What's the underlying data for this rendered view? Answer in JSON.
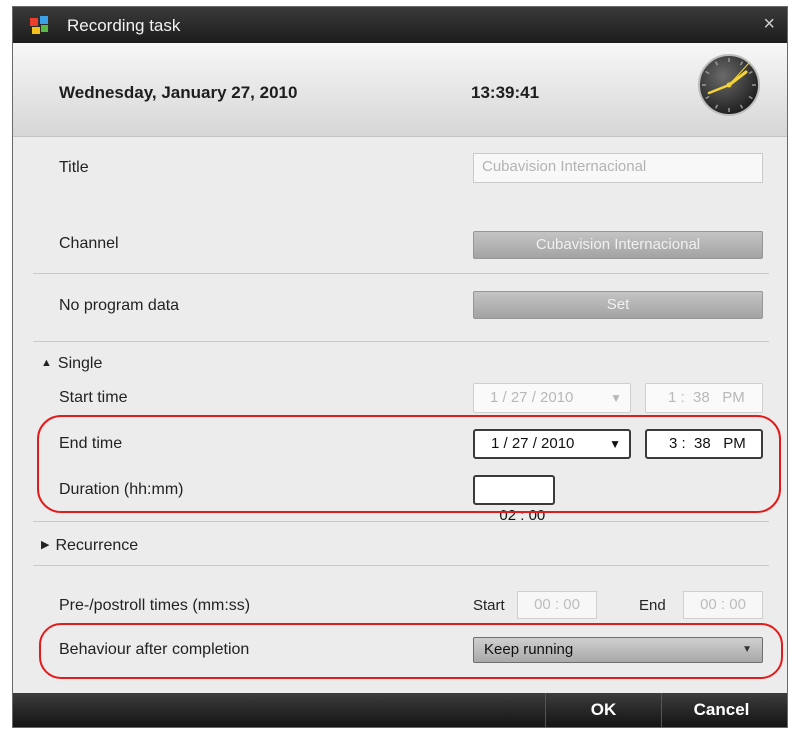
{
  "window": {
    "title": "Recording task",
    "close_label": "×"
  },
  "header": {
    "date": "Wednesday, January 27, 2010",
    "time": "13:39:41"
  },
  "title_row": {
    "label": "Title",
    "value": "Cubavision Internacional"
  },
  "channel_row": {
    "label": "Channel",
    "button": "Cubavision Internacional"
  },
  "program_row": {
    "label": "No program data",
    "button": "Set"
  },
  "single": {
    "header": "Single",
    "start_time": {
      "label": "Start time",
      "date": "1 / 27 / 2010",
      "time": "1 :  38   PM"
    },
    "end_time": {
      "label": "End time",
      "date": "1 / 27 / 2010",
      "time": "3 :  38   PM"
    },
    "duration": {
      "label": "Duration (hh:mm)",
      "value": "02 : 00"
    }
  },
  "recurrence": {
    "header": "Recurrence"
  },
  "prepost": {
    "label": "Pre-/postroll times (mm:ss)",
    "start_label": "Start",
    "start_value": "00 : 00",
    "end_label": "End",
    "end_value": "00 : 00"
  },
  "behaviour": {
    "label": "Behaviour after completion",
    "value": "Keep running"
  },
  "footer": {
    "ok": "OK",
    "cancel": "Cancel"
  },
  "colors": {
    "annotation": "#e41b1b",
    "titlebar": "#1c1c1c",
    "background": "#ececec"
  },
  "icons": [
    "app-logo-icon",
    "close-icon",
    "clock-icon",
    "triangle-down-icon",
    "triangle-right-icon",
    "chevron-down-icon"
  ]
}
